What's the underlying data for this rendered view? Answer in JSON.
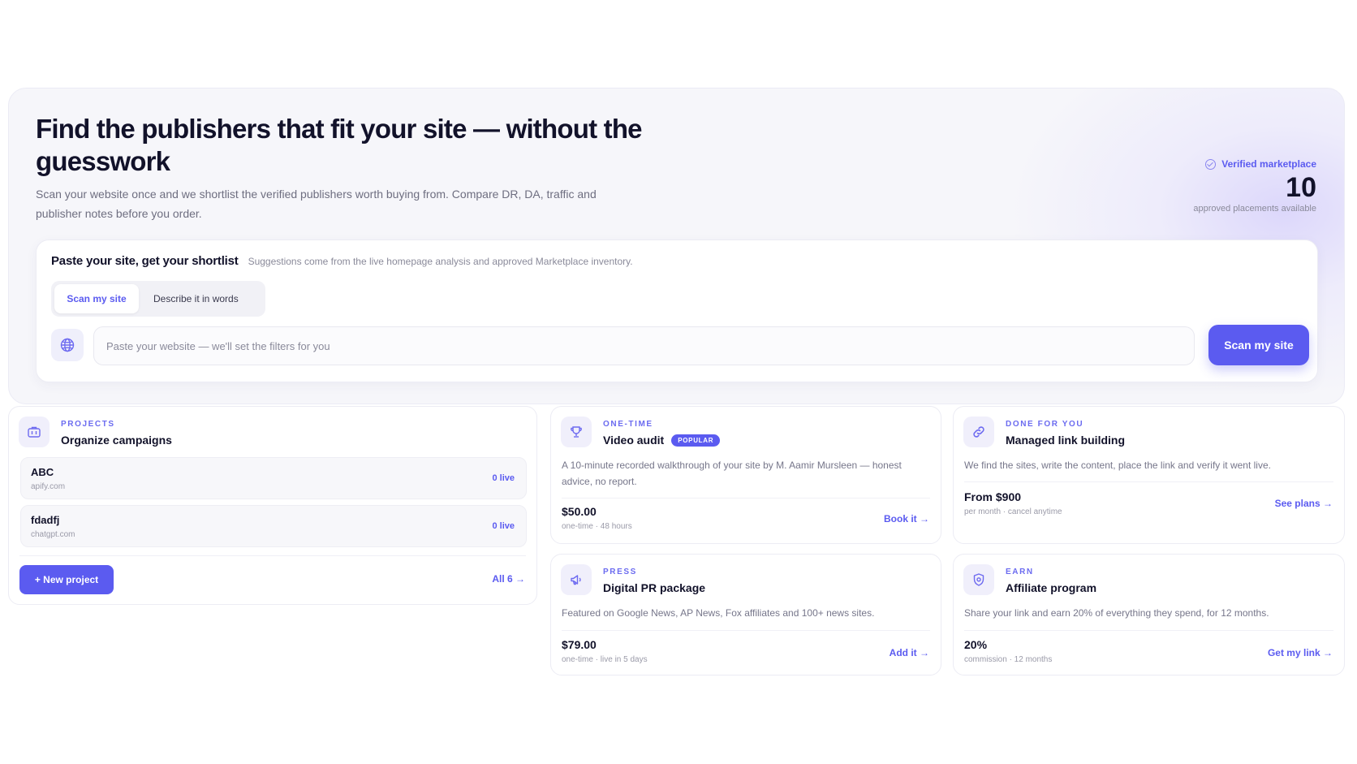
{
  "hero": {
    "title": "Find the publishers that fit your site — without the guesswork",
    "subtitle": "Scan your website once and we shortlist the verified publishers worth buying from. Compare DR, DA, traffic and publisher notes before you order.",
    "verified": {
      "icon": "check-circle-icon",
      "label": "Verified marketplace",
      "count": "10",
      "note": "approved placements available"
    }
  },
  "finder": {
    "title": "Paste your site, get your shortlist",
    "hint": "Suggestions come from the live homepage analysis and approved Marketplace inventory.",
    "tabs": [
      {
        "label": "Scan my site",
        "active": true
      },
      {
        "label": "Describe it in words",
        "active": false
      }
    ],
    "input_icon": "globe-icon",
    "input_placeholder": "Paste your website — we'll set the filters for you",
    "input_value": "",
    "submit_label": "Scan my site"
  },
  "projects": {
    "icon": "briefcase-icon",
    "eyebrow": "PROJECTS",
    "title": "Organize campaigns",
    "items": [
      {
        "name": "ABC",
        "domain": "apify.com",
        "status": "0 live"
      },
      {
        "name": "fdadfj",
        "domain": "chatgpt.com",
        "status": "0 live"
      }
    ],
    "new_label": "+ New project",
    "all_label": "All 6 →"
  },
  "offers": {
    "video": {
      "icon": "trophy-icon",
      "eyebrow": "ONE-TIME",
      "title": "Video audit",
      "badge": "POPULAR",
      "desc": "A 10-minute recorded walkthrough of your site by M. Aamir Mursleen — honest advice, no report.",
      "price": "$50.00",
      "price_note": "one-time · 48 hours",
      "cta": "Book it →"
    },
    "managed": {
      "icon": "link-icon",
      "eyebrow": "DONE FOR YOU",
      "title": "Managed link building",
      "desc": "We find the sites, write the content, place the link and verify it went live.",
      "price": "From $900",
      "price_note": "per month · cancel anytime",
      "cta": "See plans →"
    },
    "pr": {
      "icon": "megaphone-icon",
      "eyebrow": "PRESS",
      "title": "Digital PR package",
      "desc": "Featured on Google News, AP News, Fox affiliates and 100+ news sites.",
      "price": "$79.00",
      "price_note": "one-time · live in 5 days",
      "cta": "Add it →"
    },
    "affiliate": {
      "icon": "shield-icon",
      "eyebrow": "EARN",
      "title": "Affiliate program",
      "desc": "Share your link and earn 20% of everything they spend, for 12 months.",
      "price": "20%",
      "price_note": "commission · 12 months",
      "cta": "Get my link →"
    }
  },
  "colors": {
    "accent": "#5b5bf0",
    "text": "#12122a",
    "muted": "#76768a",
    "hero_bg": "#f6f6fa"
  }
}
